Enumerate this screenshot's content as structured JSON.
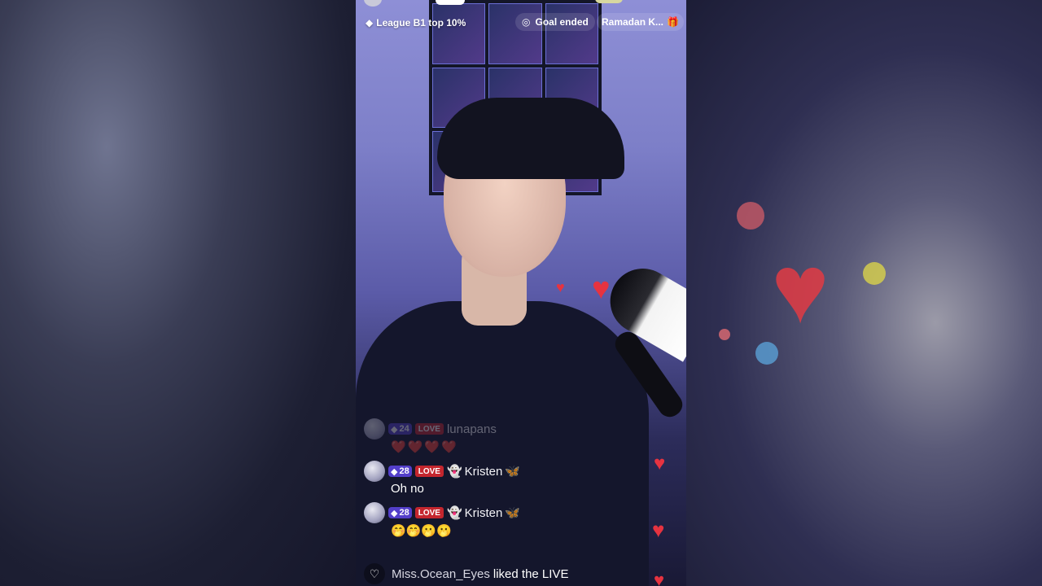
{
  "stream": {
    "league": "League B1 top 10%",
    "goal": "Goal ended",
    "event": "Ramadan K...",
    "icons": {
      "league": "diamond-icon",
      "goal": "target-icon",
      "event": "gift-icon"
    }
  },
  "chat": {
    "messages": [
      {
        "level": "24",
        "badge": "LOVE",
        "user": "lunapans",
        "text": "❤️❤️❤️❤️"
      },
      {
        "level": "28",
        "badge": "LOVE",
        "user": "Kristen",
        "text": "Oh no"
      },
      {
        "level": "28",
        "badge": "LOVE",
        "user": "Kristen",
        "text": "🤭🤭🫢🫢"
      }
    ]
  },
  "activity": {
    "user": "Miss.Ocean_Eyes",
    "action": "liked the LIVE",
    "icon": "heart-icon"
  },
  "colors": {
    "heart": "#e63340",
    "love_badge": "#c4262e",
    "level_badge": "#5e46e6"
  }
}
